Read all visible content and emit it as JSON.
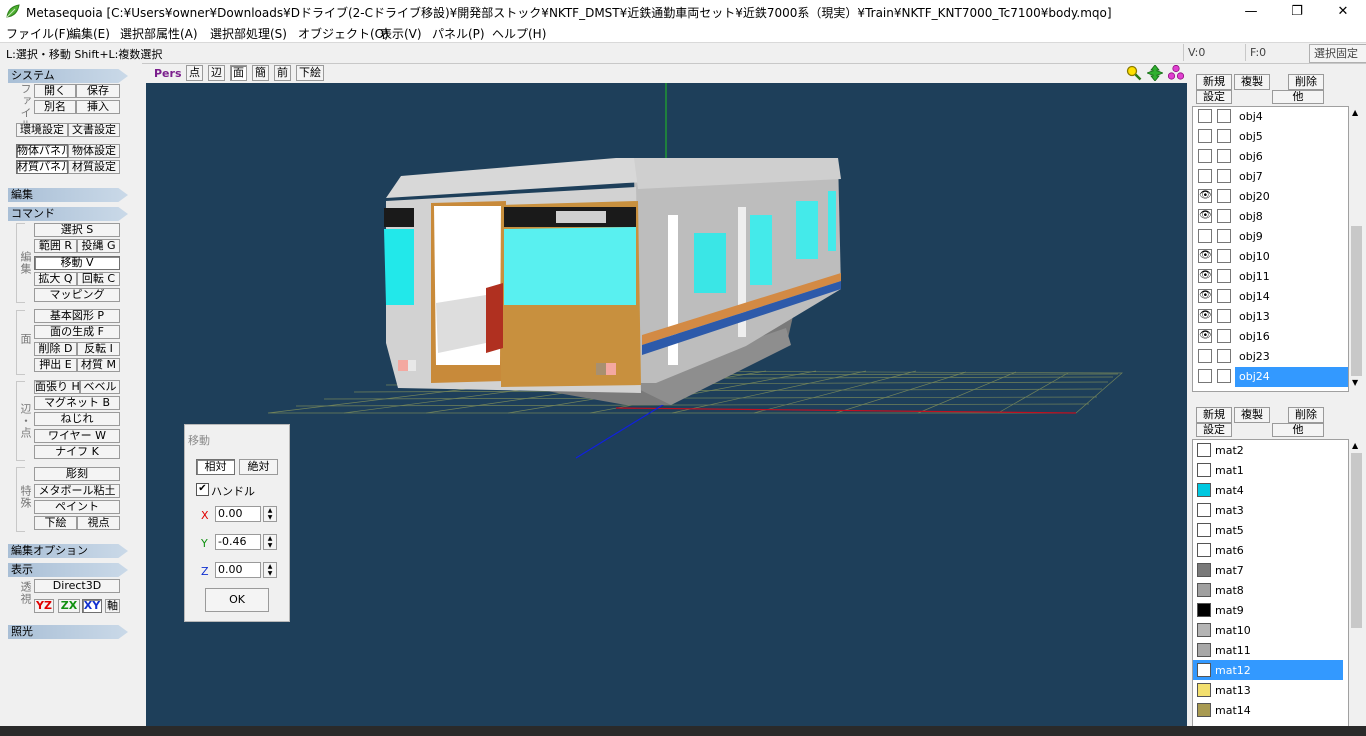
{
  "window": {
    "title": "Metasequoia [C:¥Users¥owner¥Downloads¥Dドライブ(2-Cドライブ移設)¥開発部ストック¥NKTF_DMST¥近鉄通勤車両セット¥近鉄7000系（現実）¥Train¥NKTF_KNT7000_Tc7100¥body.mqo]",
    "minimize": "—",
    "maximize": "❐",
    "close": "✕"
  },
  "menu": [
    "ファイル(F)",
    "編集(E)",
    "選択部属性(A)",
    "選択部処理(S)",
    "オブジェクト(O)",
    "表示(V)",
    "パネル(P)",
    "ヘルプ(H)"
  ],
  "status": {
    "hint": "L:選択・移動  Shift+L:複数選択",
    "v_count": "V:0",
    "f_count": "F:0",
    "lock_button": "選択固定"
  },
  "left_panel": {
    "system": {
      "header": "システム",
      "file_group_label": "ファイル",
      "open": "開く",
      "save": "保存",
      "save_as": "別名",
      "insert": "挿入",
      "env_settings": "環境設定",
      "doc_settings": "文書設定",
      "object_panel": "物体パネル",
      "object_settings": "物体設定",
      "material_panel": "材質パネル",
      "material_settings": "材質設定"
    },
    "edit_header": "編集",
    "command": {
      "header": "コマンド",
      "edit_group_label": "編集",
      "select": "選択 S",
      "range": "範囲 R",
      "lasso": "投縄 G",
      "move": "移動 V",
      "scale": "拡大 Q",
      "rotate": "回転 C",
      "mapping": "マッピング",
      "face_group_label": "面",
      "primitive": "基本図形 P",
      "make_face": "面の生成 F",
      "delete": "削除 D",
      "flip": "反転 I",
      "extrude": "押出 E",
      "material": "材質 M",
      "vertex_group_label": "辺・点",
      "face_stretch": "面張り H",
      "bevel": "ベベル",
      "magnet": "マグネット B",
      "twist": "ねじれ",
      "wire": "ワイヤー W",
      "knife": "ナイフ K",
      "special_group_label": "特殊",
      "sculpt": "彫刻",
      "metaball": "メタボール粘土",
      "paint": "ペイント",
      "underlay": "下絵",
      "viewpoint": "視点"
    },
    "edit_options_header": "編集オプション",
    "display": {
      "header": "表示",
      "persp_label": "透視",
      "direct3d": "Direct3D",
      "yz": "YZ",
      "zx": "ZX",
      "xy": "XY",
      "axis": "軸"
    },
    "lighting_header": "照光"
  },
  "viewport_toolbar": {
    "mode": "Pers",
    "point": "点",
    "edge": "辺",
    "face": "面",
    "simple": "簡",
    "front": "前",
    "underlay": "下絵"
  },
  "move_dialog": {
    "title": "移動",
    "relative": "相対",
    "absolute": "絶対",
    "handle_label": "ハンドル",
    "handle_checked": true,
    "x_label": "X",
    "x_value": "0.00",
    "y_label": "Y",
    "y_value": "-0.46",
    "z_label": "Z",
    "z_value": "0.00",
    "ok": "OK"
  },
  "object_panel": {
    "new": "新規",
    "duplicate": "複製",
    "delete": "削除",
    "settings": "設定",
    "other": "他",
    "objects": [
      {
        "name": "obj4",
        "visible": false
      },
      {
        "name": "obj5",
        "visible": false
      },
      {
        "name": "obj6",
        "visible": false
      },
      {
        "name": "obj7",
        "visible": false
      },
      {
        "name": "obj20",
        "visible": true
      },
      {
        "name": "obj8",
        "visible": true
      },
      {
        "name": "obj9",
        "visible": false
      },
      {
        "name": "obj10",
        "visible": true
      },
      {
        "name": "obj11",
        "visible": true
      },
      {
        "name": "obj14",
        "visible": true
      },
      {
        "name": "obj13",
        "visible": true
      },
      {
        "name": "obj16",
        "visible": true
      },
      {
        "name": "obj23",
        "visible": false
      },
      {
        "name": "obj24",
        "visible": false,
        "selected": true
      }
    ]
  },
  "material_panel": {
    "new": "新規",
    "duplicate": "複製",
    "delete": "削除",
    "settings": "設定",
    "other": "他",
    "materials": [
      {
        "name": "mat2",
        "color": "#ffffff"
      },
      {
        "name": "mat1",
        "color": "#ffffff"
      },
      {
        "name": "mat4",
        "color": "#00c8e0"
      },
      {
        "name": "mat3",
        "color": "#ffffff"
      },
      {
        "name": "mat5",
        "color": "#ffffff"
      },
      {
        "name": "mat6",
        "color": "#ffffff"
      },
      {
        "name": "mat7",
        "color": "#7a7a7a"
      },
      {
        "name": "mat8",
        "color": "#a0a0a0"
      },
      {
        "name": "mat9",
        "color": "#000000"
      },
      {
        "name": "mat10",
        "color": "#b4b4b4"
      },
      {
        "name": "mat11",
        "color": "#a8a8a8"
      },
      {
        "name": "mat12",
        "color": "#ffffff",
        "selected": true
      },
      {
        "name": "mat13",
        "color": "#f2df6e"
      },
      {
        "name": "mat14",
        "color": "#a89a52"
      }
    ]
  },
  "colors": {
    "viewport_bg": "#1e3f5a",
    "selection": "#3399ff",
    "panel_header": "#a9bfd6"
  }
}
